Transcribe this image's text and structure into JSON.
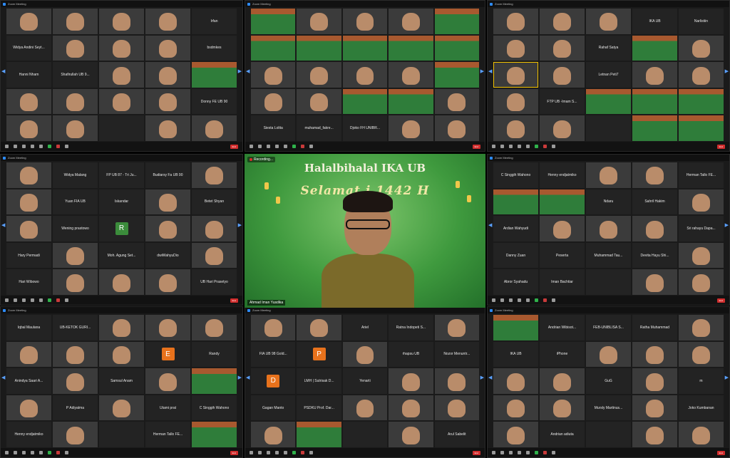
{
  "windows": [
    {
      "id": "w1",
      "title": "Zoom Meeting",
      "cols": 5,
      "tiles": [
        {
          "kind": "video"
        },
        {
          "kind": "video"
        },
        {
          "kind": "video"
        },
        {
          "kind": "video"
        },
        {
          "kind": "name",
          "label": "Irfan"
        },
        {
          "kind": "name",
          "label": "Widya Andini Seyt..."
        },
        {
          "kind": "video"
        },
        {
          "kind": "video"
        },
        {
          "kind": "video"
        },
        {
          "kind": "name",
          "label": "bsdmkes"
        },
        {
          "kind": "name",
          "label": "Hanni Nham"
        },
        {
          "kind": "name",
          "label": "Shafirullah UB 9..."
        },
        {
          "kind": "video"
        },
        {
          "kind": "video"
        },
        {
          "kind": "banner"
        },
        {
          "kind": "video"
        },
        {
          "kind": "video"
        },
        {
          "kind": "video"
        },
        {
          "kind": "video"
        },
        {
          "kind": "name",
          "label": "Donny FE UB 90"
        },
        {
          "kind": "video"
        },
        {
          "kind": "video"
        },
        {
          "kind": "name",
          "label": ""
        },
        {
          "kind": "video"
        },
        {
          "kind": "video"
        }
      ]
    },
    {
      "id": "w2",
      "title": "Zoom Meeting",
      "cols": 5,
      "tiles": [
        {
          "kind": "banner"
        },
        {
          "kind": "video"
        },
        {
          "kind": "video"
        },
        {
          "kind": "video"
        },
        {
          "kind": "banner"
        },
        {
          "kind": "banner"
        },
        {
          "kind": "banner"
        },
        {
          "kind": "banner"
        },
        {
          "kind": "banner"
        },
        {
          "kind": "banner"
        },
        {
          "kind": "video"
        },
        {
          "kind": "video"
        },
        {
          "kind": "video"
        },
        {
          "kind": "video"
        },
        {
          "kind": "banner"
        },
        {
          "kind": "video"
        },
        {
          "kind": "video"
        },
        {
          "kind": "banner"
        },
        {
          "kind": "banner"
        },
        {
          "kind": "video"
        },
        {
          "kind": "name",
          "label": "Siesta Lolita"
        },
        {
          "kind": "name",
          "label": "muhamad_fakre..."
        },
        {
          "kind": "name",
          "label": "Djoko FH UNIBR..."
        },
        {
          "kind": "video"
        },
        {
          "kind": "video"
        }
      ]
    },
    {
      "id": "w3",
      "title": "Zoom Meeting",
      "cols": 5,
      "tiles": [
        {
          "kind": "video"
        },
        {
          "kind": "video"
        },
        {
          "kind": "video"
        },
        {
          "kind": "name",
          "label": "IKA UB"
        },
        {
          "kind": "name",
          "label": "Narlistiin"
        },
        {
          "kind": "video"
        },
        {
          "kind": "video"
        },
        {
          "kind": "name",
          "label": "Rahaf Satya"
        },
        {
          "kind": "banner"
        },
        {
          "kind": "video"
        },
        {
          "kind": "video",
          "active": true
        },
        {
          "kind": "video"
        },
        {
          "kind": "name",
          "label": "Letnan Peti7"
        },
        {
          "kind": "video"
        },
        {
          "kind": "video"
        },
        {
          "kind": "video"
        },
        {
          "kind": "name",
          "label": "FTP UB -Imam S..."
        },
        {
          "kind": "banner"
        },
        {
          "kind": "banner"
        },
        {
          "kind": "banner"
        },
        {
          "kind": "video"
        },
        {
          "kind": "video"
        },
        {
          "kind": "name",
          "label": ""
        },
        {
          "kind": "banner"
        },
        {
          "kind": "banner"
        }
      ]
    },
    {
      "id": "w4",
      "title": "Zoom Meeting",
      "cols": 5,
      "tiles": [
        {
          "kind": "video"
        },
        {
          "kind": "name",
          "label": "Widya Malang"
        },
        {
          "kind": "name",
          "label": "FP UB 87 - Tri Ju..."
        },
        {
          "kind": "name",
          "label": "Budiarsy Fa UB 90"
        },
        {
          "kind": "video"
        },
        {
          "kind": "video"
        },
        {
          "kind": "name",
          "label": "Yuan FIA UB"
        },
        {
          "kind": "name",
          "label": "Iskandar"
        },
        {
          "kind": "video"
        },
        {
          "kind": "name",
          "label": "Betet Shyan"
        },
        {
          "kind": "video"
        },
        {
          "kind": "name",
          "label": "Wening prastowo"
        },
        {
          "kind": "letter",
          "letter": "R",
          "color": "#3b8c3b"
        },
        {
          "kind": "video"
        },
        {
          "kind": "video"
        },
        {
          "kind": "name",
          "label": "Hary Permadi"
        },
        {
          "kind": "video"
        },
        {
          "kind": "name",
          "label": "Moh. Agung Set..."
        },
        {
          "kind": "name",
          "label": "dwiWahyuDio"
        },
        {
          "kind": "video"
        },
        {
          "kind": "name",
          "label": "Hari Wibowo"
        },
        {
          "kind": "video"
        },
        {
          "kind": "video"
        },
        {
          "kind": "video"
        },
        {
          "kind": "name",
          "label": "UB Hari Prasetyo"
        }
      ]
    },
    {
      "id": "w6",
      "title": "Zoom Meeting",
      "cols": 5,
      "tiles": [
        {
          "kind": "name",
          "label": "C Singgih Wahono"
        },
        {
          "kind": "name",
          "label": "Henny endjatmiko"
        },
        {
          "kind": "video"
        },
        {
          "kind": "video"
        },
        {
          "kind": "name",
          "label": "Herman Tallo FE..."
        },
        {
          "kind": "banner"
        },
        {
          "kind": "banner"
        },
        {
          "kind": "name",
          "label": "Ndaru"
        },
        {
          "kind": "name",
          "label": "Sahril Hakim"
        },
        {
          "kind": "video"
        },
        {
          "kind": "name",
          "label": "Ardian Wahyudi"
        },
        {
          "kind": "video"
        },
        {
          "kind": "video"
        },
        {
          "kind": "video"
        },
        {
          "kind": "name",
          "label": "Sri rahayu Dapa..."
        },
        {
          "kind": "name",
          "label": "Danny Zuan"
        },
        {
          "kind": "name",
          "label": "Peserta"
        },
        {
          "kind": "name",
          "label": "Muhammad Tau..."
        },
        {
          "kind": "name",
          "label": "Devita Hayu Shi..."
        },
        {
          "kind": "video"
        },
        {
          "kind": "name",
          "label": "Abror Syahadu"
        },
        {
          "kind": "name",
          "label": "Iman Bachtiar"
        },
        {
          "kind": "name",
          "label": ""
        },
        {
          "kind": "video"
        },
        {
          "kind": "video"
        }
      ]
    },
    {
      "id": "w7",
      "title": "Zoom Meeting",
      "cols": 5,
      "tiles": [
        {
          "kind": "name",
          "label": "Iqbal Maulana"
        },
        {
          "kind": "name",
          "label": "UB-KETOK GURI..."
        },
        {
          "kind": "video"
        },
        {
          "kind": "video"
        },
        {
          "kind": "video"
        },
        {
          "kind": "video"
        },
        {
          "kind": "video"
        },
        {
          "kind": "video"
        },
        {
          "kind": "letter",
          "letter": "E",
          "color": "#e8721c"
        },
        {
          "kind": "name",
          "label": "Randy"
        },
        {
          "kind": "name",
          "label": "Anindya Saari A..."
        },
        {
          "kind": "video"
        },
        {
          "kind": "name",
          "label": "Samsul Anam"
        },
        {
          "kind": "video"
        },
        {
          "kind": "banner"
        },
        {
          "kind": "video"
        },
        {
          "kind": "name",
          "label": "P Adiyatma"
        },
        {
          "kind": "video"
        },
        {
          "kind": "name",
          "label": "Utami prat"
        },
        {
          "kind": "name",
          "label": "C Singgih Wahono"
        },
        {
          "kind": "name",
          "label": "Henny endjatmiko"
        },
        {
          "kind": "video"
        },
        {
          "kind": "name",
          "label": ""
        },
        {
          "kind": "name",
          "label": "Herman Tallo FE..."
        },
        {
          "kind": "banner"
        }
      ]
    },
    {
      "id": "w8",
      "title": "Zoom Meeting",
      "cols": 5,
      "tiles": [
        {
          "kind": "video"
        },
        {
          "kind": "video"
        },
        {
          "kind": "name",
          "label": "Ariel"
        },
        {
          "kind": "name",
          "label": "Ratna Indopeti S..."
        },
        {
          "kind": "video"
        },
        {
          "kind": "name",
          "label": "FIA UB 98 Gold..."
        },
        {
          "kind": "letter",
          "letter": "P",
          "color": "#e8721c"
        },
        {
          "kind": "video"
        },
        {
          "kind": "name",
          "label": "rhapsu UB"
        },
        {
          "kind": "name",
          "label": "Nozor Menuntr..."
        },
        {
          "kind": "letter",
          "letter": "D",
          "color": "#e8721c"
        },
        {
          "kind": "name",
          "label": "LMH | Sutrisak D..."
        },
        {
          "kind": "name",
          "label": "Yenarti"
        },
        {
          "kind": "video"
        },
        {
          "kind": "video"
        },
        {
          "kind": "name",
          "label": "Gagan Manto"
        },
        {
          "kind": "name",
          "label": "PSDKU Prof. Dar..."
        },
        {
          "kind": "video"
        },
        {
          "kind": "video"
        },
        {
          "kind": "video"
        },
        {
          "kind": "video"
        },
        {
          "kind": "banner"
        },
        {
          "kind": "name",
          "label": ""
        },
        {
          "kind": "video"
        },
        {
          "kind": "name",
          "label": "Arul Sabelit"
        }
      ]
    },
    {
      "id": "w9",
      "title": "Zoom Meeting",
      "cols": 5,
      "tiles": [
        {
          "kind": "banner"
        },
        {
          "kind": "name",
          "label": "Andrian Wibisot..."
        },
        {
          "kind": "name",
          "label": "FEB-UNIBLISA S..."
        },
        {
          "kind": "name",
          "label": "Ratha Muhammad"
        },
        {
          "kind": "video"
        },
        {
          "kind": "name",
          "label": "IKA UB"
        },
        {
          "kind": "name",
          "label": "iPhone"
        },
        {
          "kind": "video"
        },
        {
          "kind": "video"
        },
        {
          "kind": "video"
        },
        {
          "kind": "video"
        },
        {
          "kind": "video"
        },
        {
          "kind": "name",
          "label": "GuG"
        },
        {
          "kind": "video"
        },
        {
          "kind": "name",
          "label": "m"
        },
        {
          "kind": "video"
        },
        {
          "kind": "video"
        },
        {
          "kind": "name",
          "label": "Mursly Martinus..."
        },
        {
          "kind": "video"
        },
        {
          "kind": "name",
          "label": "Joko Kumbanan"
        },
        {
          "kind": "video"
        },
        {
          "kind": "name",
          "label": "Andrian adiuta"
        },
        {
          "kind": "name",
          "label": ""
        },
        {
          "kind": "video"
        },
        {
          "kind": "video"
        }
      ]
    }
  ],
  "speaker": {
    "recording_label": "Recording...",
    "title": "Halalbihalal IKA UB",
    "subtitle": "Selamat        i 1442 H",
    "name": "Ahmad Iman Yusdika"
  },
  "toolbar": {
    "end_label": "End"
  }
}
